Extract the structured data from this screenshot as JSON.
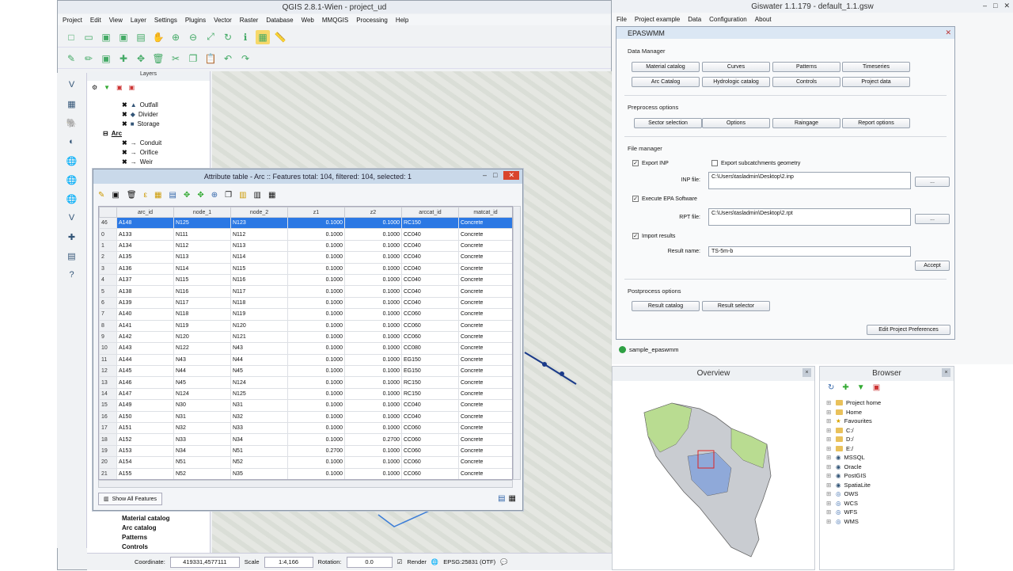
{
  "qgis": {
    "title": "QGIS 2.8.1-Wien - project_ud",
    "menu": [
      "Project",
      "Edit",
      "View",
      "Layer",
      "Settings",
      "Plugins",
      "Vector",
      "Raster",
      "Database",
      "Web",
      "MMQGIS",
      "Processing",
      "Help"
    ],
    "layers_title": "Layers",
    "layer_items": [
      {
        "label": "Outfall",
        "sym": "▲"
      },
      {
        "label": "Divider",
        "sym": "◆"
      },
      {
        "label": "Storage",
        "sym": "■"
      }
    ],
    "arc_group": "Arc",
    "arc_items": [
      "Conduit",
      "Orifice",
      "Weir"
    ],
    "bottom_layers": [
      "Material catalog",
      "Arc catalog",
      "Patterns",
      "Controls"
    ],
    "status": {
      "coordinate_label": "Coordinate:",
      "coordinate": "419331,4577111",
      "scale_label": "Scale",
      "scale": "1:4,166",
      "rotation_label": "Rotation:",
      "rotation": "0.0",
      "render_label": "Render",
      "crs": "EPSG:25831 (OTF)"
    }
  },
  "attr": {
    "title": "Attribute table - Arc :: Features total: 104, filtered: 104, selected: 1",
    "columns": [
      "arc_id",
      "node_1",
      "node_2",
      "z1",
      "z2",
      "arccat_id",
      "matcat_id"
    ],
    "rows": [
      [
        "46",
        "A148",
        "N125",
        "N123",
        "0.1000",
        "0.1000",
        "RC150",
        "Concrete"
      ],
      [
        "0",
        "A133",
        "N111",
        "N112",
        "0.1000",
        "0.1000",
        "CC040",
        "Concrete"
      ],
      [
        "1",
        "A134",
        "N112",
        "N113",
        "0.1000",
        "0.1000",
        "CC040",
        "Concrete"
      ],
      [
        "2",
        "A135",
        "N113",
        "N114",
        "0.1000",
        "0.1000",
        "CC040",
        "Concrete"
      ],
      [
        "3",
        "A136",
        "N114",
        "N115",
        "0.1000",
        "0.1000",
        "CC040",
        "Concrete"
      ],
      [
        "4",
        "A137",
        "N115",
        "N116",
        "0.1000",
        "0.1000",
        "CC040",
        "Concrete"
      ],
      [
        "5",
        "A138",
        "N116",
        "N117",
        "0.1000",
        "0.1000",
        "CC040",
        "Concrete"
      ],
      [
        "6",
        "A139",
        "N117",
        "N118",
        "0.1000",
        "0.1000",
        "CC040",
        "Concrete"
      ],
      [
        "7",
        "A140",
        "N118",
        "N119",
        "0.1000",
        "0.1000",
        "CC060",
        "Concrete"
      ],
      [
        "8",
        "A141",
        "N119",
        "N120",
        "0.1000",
        "0.1000",
        "CC060",
        "Concrete"
      ],
      [
        "9",
        "A142",
        "N120",
        "N121",
        "0.1000",
        "0.1000",
        "CC060",
        "Concrete"
      ],
      [
        "10",
        "A143",
        "N122",
        "N43",
        "0.1000",
        "0.1000",
        "CC080",
        "Concrete"
      ],
      [
        "11",
        "A144",
        "N43",
        "N44",
        "0.1000",
        "0.1000",
        "EG150",
        "Concrete"
      ],
      [
        "12",
        "A145",
        "N44",
        "N45",
        "0.1000",
        "0.1000",
        "EG150",
        "Concrete"
      ],
      [
        "13",
        "A146",
        "N45",
        "N124",
        "0.1000",
        "0.1000",
        "RC150",
        "Concrete"
      ],
      [
        "14",
        "A147",
        "N124",
        "N125",
        "0.1000",
        "0.1000",
        "RC150",
        "Concrete"
      ],
      [
        "15",
        "A149",
        "N30",
        "N31",
        "0.1000",
        "0.1000",
        "CC040",
        "Concrete"
      ],
      [
        "16",
        "A150",
        "N31",
        "N32",
        "0.1000",
        "0.1000",
        "CC040",
        "Concrete"
      ],
      [
        "17",
        "A151",
        "N32",
        "N33",
        "0.1000",
        "0.1000",
        "CC060",
        "Concrete"
      ],
      [
        "18",
        "A152",
        "N33",
        "N34",
        "0.1000",
        "0.2700",
        "CC060",
        "Concrete"
      ],
      [
        "19",
        "A153",
        "N34",
        "N51",
        "0.2700",
        "0.1000",
        "CC060",
        "Concrete"
      ],
      [
        "20",
        "A154",
        "N51",
        "N52",
        "0.1000",
        "0.1000",
        "CC060",
        "Concrete"
      ],
      [
        "21",
        "A155",
        "N52",
        "N35",
        "0.1000",
        "0.1000",
        "CC060",
        "Concrete"
      ]
    ],
    "show_all": "Show All Features"
  },
  "giswater": {
    "title": "Giswater 1.1.179 - default_1.1.gsw",
    "menu": [
      "File",
      "Project example",
      "Data",
      "Configuration",
      "About"
    ],
    "epa_title": "EPASWMM",
    "data_manager": "Data Manager",
    "dm_buttons": [
      "Material catalog",
      "Curves",
      "Patterns",
      "Timeseries",
      "Arc Catalog",
      "Hydrologic catalog",
      "Controls",
      "Project data"
    ],
    "preprocess": "Preprocess options",
    "pre_buttons": [
      "Sector selection",
      "Options",
      "Raingage",
      "Report options"
    ],
    "file_manager": "File manager",
    "export_inp": "Export INP",
    "export_sub": "Export subcatchments geometry",
    "inp_label": "INP file:",
    "inp_value": "C:\\Users\\tasladmin\\Desktop\\2.inp",
    "exec_epa": "Execute EPA Software",
    "rpt_label": "RPT file:",
    "rpt_value": "C:\\Users\\tasladmin\\Desktop\\2.rpt",
    "import_results": "Import results",
    "result_label": "Result name:",
    "result_value": "TS-5m-b",
    "accept": "Accept",
    "browse": "...",
    "postprocess": "Postprocess options",
    "post_buttons": [
      "Result catalog",
      "Result selector"
    ],
    "edit_prefs": "Edit Project Preferences",
    "sample": "sample_epaswmm"
  },
  "overview_title": "Overview",
  "browser": {
    "title": "Browser",
    "items": [
      "Project home",
      "Home",
      "Favourites",
      "C:/",
      "D:/",
      "E:/",
      "MSSQL",
      "Oracle",
      "PostGIS",
      "SpatiaLite",
      "OWS",
      "WCS",
      "WFS",
      "WMS"
    ]
  }
}
